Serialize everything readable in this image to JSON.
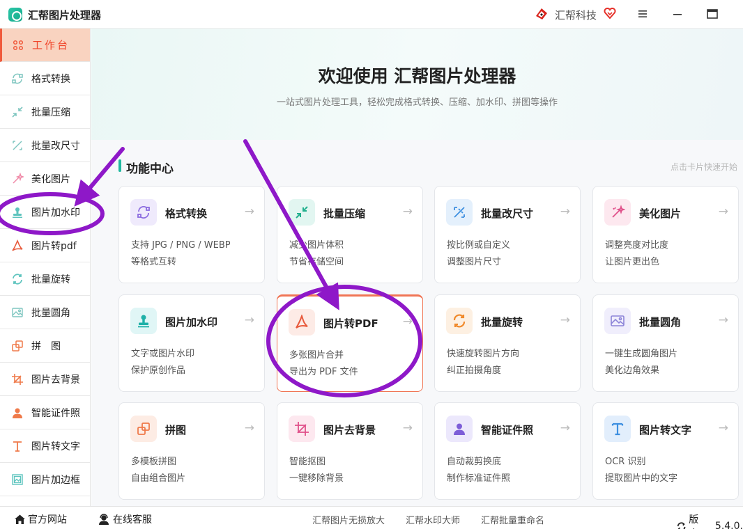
{
  "titlebar": {
    "app_title": "汇帮图片处理器",
    "brand": "汇帮科技",
    "logo_icon": "app-logo-icon",
    "brand_icon": "huibang-brand-icon",
    "vip_icon": "heart-badge-icon"
  },
  "sidebar": {
    "items": [
      {
        "label": "工作台",
        "icon": "grid-icon",
        "active": true
      },
      {
        "label": "格式转换",
        "icon": "convert-icon"
      },
      {
        "label": "批量压缩",
        "icon": "compress-icon"
      },
      {
        "label": "批量改尺寸",
        "icon": "resize-icon"
      },
      {
        "label": "美化图片",
        "icon": "beautify-icon"
      },
      {
        "label": "图片加水印",
        "icon": "stamp-icon"
      },
      {
        "label": "图片转pdf",
        "icon": "pdf-icon"
      },
      {
        "label": "批量旋转",
        "icon": "rotate-icon"
      },
      {
        "label": "批量圆角",
        "icon": "image-icon"
      },
      {
        "label": "拼　图",
        "icon": "collage-icon"
      },
      {
        "label": "图片去背景",
        "icon": "crop-icon"
      },
      {
        "label": "智能证件照",
        "icon": "person-icon"
      },
      {
        "label": "图片转文字",
        "icon": "text-icon"
      },
      {
        "label": "图片加边框",
        "icon": "frame-icon"
      }
    ]
  },
  "hero": {
    "title": "欢迎使用 汇帮图片处理器",
    "subtitle": "一站式图片处理工具，轻松完成格式转换、压缩、加水印、拼图等操作"
  },
  "section": {
    "title": "功能中心",
    "hint": "点击卡片快速开始"
  },
  "cards": [
    {
      "title": "格式转换",
      "line1": "支持 JPG / PNG / WEBP",
      "line2": "等格式互转",
      "icon": "convert-icon",
      "bg": "#efeafc",
      "fg": "#8c6ce0"
    },
    {
      "title": "批量压缩",
      "line1": "减少图片体积",
      "line2": "节省存储空间",
      "icon": "compress-icon",
      "bg": "#e2f6f1",
      "fg": "#22b08e"
    },
    {
      "title": "批量改尺寸",
      "line1": "按比例或自定义",
      "line2": "调整图片尺寸",
      "icon": "resize-icon",
      "bg": "#e4f0fc",
      "fg": "#3d8fe0"
    },
    {
      "title": "美化图片",
      "line1": "调整亮度对比度",
      "line2": "让图片更出色",
      "icon": "beautify-icon",
      "bg": "#fde8ef",
      "fg": "#e0508a"
    },
    {
      "title": "图片加水印",
      "line1": "文字或图片水印",
      "line2": "保护原创作品",
      "icon": "stamp-icon",
      "bg": "#e0f6f6",
      "fg": "#1fb0a8"
    },
    {
      "title": "图片转PDF",
      "line1": "多张图片合并",
      "line2": "导出为 PDF 文件",
      "icon": "pdf-icon",
      "bg": "#fdebe6",
      "fg": "#e85a3c",
      "selected": true
    },
    {
      "title": "批量旋转",
      "line1": "快速旋转图片方向",
      "line2": "纠正拍摄角度",
      "icon": "rotate-icon",
      "bg": "#fdf0e2",
      "fg": "#f08a2c"
    },
    {
      "title": "批量圆角",
      "line1": "一键生成圆角图片",
      "line2": "美化边角效果",
      "icon": "image-icon",
      "bg": "#f0eefc",
      "fg": "#8c84d8"
    },
    {
      "title": "拼图",
      "line1": "多模板拼图",
      "line2": "自由组合图片",
      "icon": "collage-icon",
      "bg": "#fdece4",
      "fg": "#ef7a4a"
    },
    {
      "title": "图片去背景",
      "line1": "智能抠图",
      "line2": "一键移除背景",
      "icon": "crop-icon",
      "bg": "#fde8ef",
      "fg": "#e0508a"
    },
    {
      "title": "智能证件照",
      "line1": "自动裁剪换底",
      "line2": "制作标准证件照",
      "icon": "person-icon",
      "bg": "#ece8fc",
      "fg": "#7d5ed8"
    },
    {
      "title": "图片转文字",
      "line1": "OCR 识别",
      "line2": "提取图片中的文字",
      "icon": "text-icon",
      "bg": "#e2eefc",
      "fg": "#3d8fe0"
    }
  ],
  "bottombar": {
    "website": "官方网站",
    "support": "在线客服",
    "links": [
      "汇帮图片无损放大",
      "汇帮水印大师",
      "汇帮批量重命名"
    ],
    "version_label": "版本：",
    "version": "5.4.0."
  },
  "colors": {
    "accent": "#f05a3c",
    "teal": "#20b9a0",
    "annotation": "#8e18c8"
  }
}
